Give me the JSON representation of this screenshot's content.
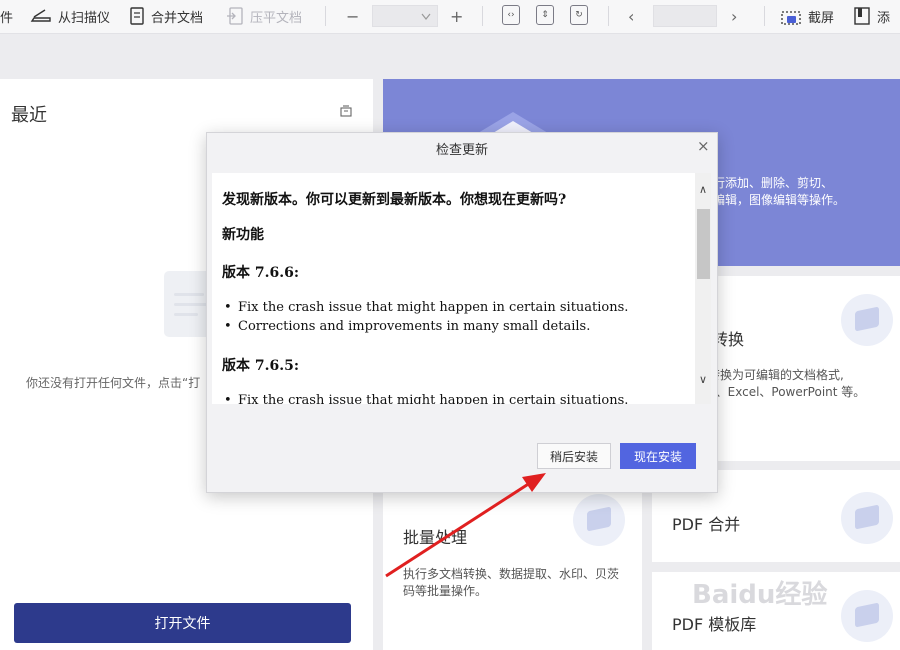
{
  "toolbar": {
    "item_file_partial": "件",
    "from_scanner": "从扫描仪",
    "merge_docs": "合并文档",
    "flatten_docs": "压平文档",
    "zoom_out": "−",
    "zoom_value": "",
    "zoom_in": "+",
    "prev_page": "‹",
    "page_value": "",
    "next_page": "›",
    "screenshot": "截屏",
    "add_partial": "添"
  },
  "left": {
    "recent_title": "最近",
    "empty_text": "你还没有打开任何文件，点击“打",
    "open_file_button": "打开文件"
  },
  "banner": {
    "desc_line1": "行添加、删除、剪切、",
    "desc_line2": "编辑，图像编辑等操作。"
  },
  "cards": {
    "convert_title_partial": "转换",
    "convert_desc_line1": "转换为可编辑的文档格式,",
    "convert_desc_line2": "d、Excel、PowerPoint 等。",
    "batch_title": "批量处理",
    "batch_desc_line1": "执行多文档转换、数据提取、水印、贝茨",
    "batch_desc_line2": "码等批量操作。",
    "merge_title": "PDF 合并",
    "template_title": "PDF 模板库"
  },
  "dialog": {
    "title": "检查更新",
    "close_symbol": "×",
    "message": "发现新版本。你可以更新到最新版本。你想现在更新吗?",
    "new_features": "新功能",
    "releases": [
      {
        "heading": "版本  7.6.6:",
        "items": [
          "Fix the crash issue that might happen in certain situations.",
          "Corrections and improvements in many small details."
        ]
      },
      {
        "heading": "版本  7.6.5:",
        "items": [
          "Fix the crash issue that might happen in certain situations."
        ]
      }
    ],
    "later_button": "稍后安装",
    "install_now_button": "现在安装"
  },
  "watermark": "Baidu经验",
  "colors": {
    "primary_button": "#2d3a8c",
    "install_button": "#5265e0",
    "banner": "#7c86d6",
    "annotation_arrow": "#e02020"
  }
}
